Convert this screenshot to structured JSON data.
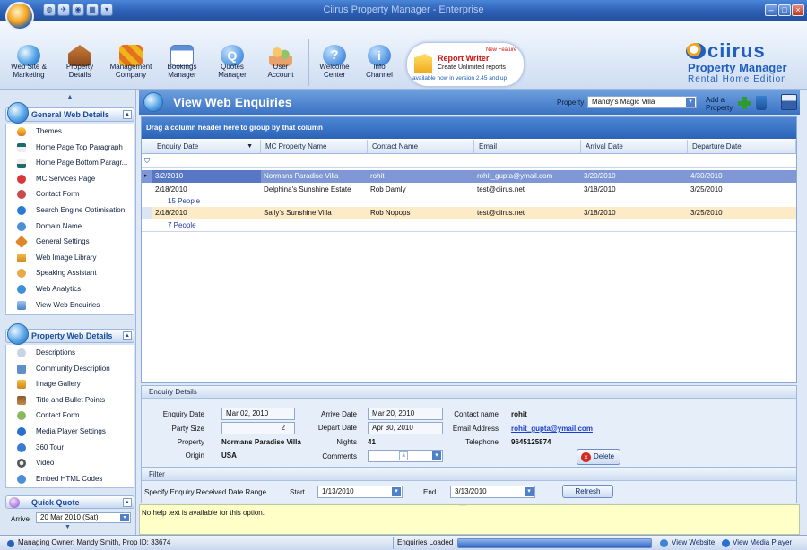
{
  "window": {
    "title": "Ciirus Property Manager - Enterprise"
  },
  "ribbon": {
    "buttons": [
      {
        "label1": "Web Site &",
        "label2": "Marketing"
      },
      {
        "label1": "Property",
        "label2": "Details"
      },
      {
        "label1": "Management",
        "label2": "Company"
      },
      {
        "label1": "Bookings",
        "label2": "Manager"
      },
      {
        "label1": "Quotes",
        "label2": "Manager"
      },
      {
        "label1": "User",
        "label2": "Account"
      },
      {
        "label1": "Welcome",
        "label2": "Center"
      },
      {
        "label1": "Info",
        "label2": "Channel"
      }
    ],
    "report_writer": {
      "badge": "New Feature",
      "title": "Report Writer",
      "line1": "Create Unlimited reports",
      "line2": "available now in version 2.45 and up"
    },
    "brand": {
      "name": "ciirus",
      "line1": "Property Manager",
      "line2": "Rental Home Edition"
    }
  },
  "sidebar": {
    "general": {
      "title": "General Web Details",
      "items": [
        "Themes",
        "Home Page Top Paragraph",
        "Home Page Bottom Paragr...",
        "MC Services Page",
        "Contact Form",
        "Search Engine Optimisation",
        "Domain Name",
        "General Settings",
        "Web Image Library",
        "Speaking Assistant",
        "Web Analytics",
        "View Web Enquiries"
      ]
    },
    "property": {
      "title": "Property Web Details",
      "items": [
        "Descriptions",
        "Community Description",
        "Image Gallery",
        "Title and Bullet Points",
        "Contact Form",
        "Media Player Settings",
        "360 Tour",
        "Video",
        "Embed HTML Codes"
      ]
    },
    "quick_quote": {
      "title": "Quick Quote",
      "arrive_label": "Arrive",
      "arrive_value": "20 Mar 2010 (Sat)"
    }
  },
  "view": {
    "title": "View Web Enquiries",
    "property_label": "Property",
    "property_value": "Mandy's Magic Villa",
    "add_label1": "Add a",
    "add_label2": "Property"
  },
  "grid": {
    "drag_hint": "Drag a column header here to group by that column",
    "columns": [
      "Enquiry Date",
      "MC Property Name",
      "Contact Name",
      "Email",
      "Arrival Date",
      "Departure Date"
    ],
    "rows": [
      {
        "cells": [
          "3/2/2010",
          "Normans Paradise Villa",
          "rohit",
          "rohit_gupta@ymail.com",
          "3/20/2010",
          "4/30/2010"
        ],
        "state": "selected"
      },
      {
        "cells": [
          "2/18/2010",
          "Delphina's Sunshine Estate",
          "Rob Damly",
          "test@ciirus.net",
          "3/18/2010",
          "3/25/2010"
        ],
        "state": "normal",
        "people": "15 People"
      },
      {
        "cells": [
          "2/18/2010",
          "Sally's Sunshine Villa",
          "Rob Nopops",
          "test@ciirus.net",
          "3/18/2010",
          "3/25/2010"
        ],
        "state": "highlight",
        "people": "7 People"
      }
    ]
  },
  "details": {
    "title": "Enquiry Details",
    "enquiry_date_label": "Enquiry Date",
    "enquiry_date": "Mar 02, 2010",
    "party_size_label": "Party Size",
    "party_size": "2",
    "property_label": "Property",
    "property": "Normans Paradise Villa",
    "origin_label": "Origin",
    "origin": "USA",
    "arrive_date_label": "Arrive Date",
    "arrive_date": "Mar 20, 2010",
    "depart_date_label": "Depart Date",
    "depart_date": "Apr 30, 2010",
    "nights_label": "Nights",
    "nights": "41",
    "comments_label": "Comments",
    "contact_label": "Contact name",
    "contact": "rohit",
    "email_label": "Email Address",
    "email": "rohit_gupta@ymail.com",
    "telephone_label": "Telephone",
    "telephone": "9645125874",
    "delete_label": "Delete"
  },
  "filter": {
    "title": "Filter",
    "range_label": "Specify Enquiry Received Date Range",
    "start_label": "Start",
    "start_value": "1/13/2010",
    "end_label": "End",
    "end_value": "3/13/2010",
    "refresh_label": "Refresh"
  },
  "help": {
    "text": "No help text is available for this option."
  },
  "status": {
    "owner": "Managing Owner: Mandy Smith, Prop ID: 33674",
    "loaded": "Enquiries Loaded",
    "view_website": "View Website",
    "view_media": "View Media Player"
  }
}
